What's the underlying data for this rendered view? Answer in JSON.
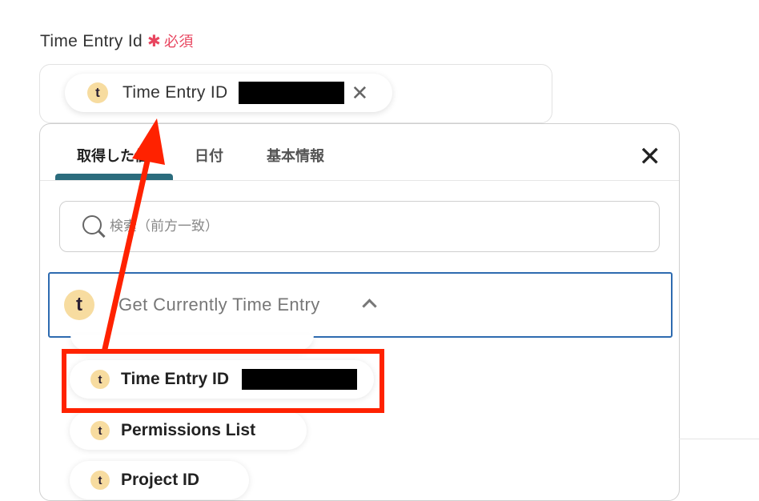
{
  "field": {
    "label": "Time Entry Id",
    "required_star": "✱",
    "required_text": "必須"
  },
  "token": {
    "icon_letter": "t",
    "label": "Time Entry ID",
    "remove_icon": "✕"
  },
  "panel": {
    "tabs": [
      {
        "label": "取得した値"
      },
      {
        "label": "日付"
      },
      {
        "label": "基本情報"
      }
    ],
    "close_icon": "✕",
    "search": {
      "placeholder": "検索（前方一致）"
    },
    "section": {
      "icon_letter": "t",
      "title": "Get Currently Time Entry"
    },
    "items": [
      {
        "icon_letter": "t",
        "label": "Time Entry ID"
      },
      {
        "icon_letter": "t",
        "label": "Permissions List"
      },
      {
        "icon_letter": "t",
        "label": "Project ID"
      }
    ]
  },
  "colors": {
    "required": "#e8455f",
    "tab_indicator": "#2b6c7d",
    "section_border": "#2e6bb0",
    "annotation": "#ff2200",
    "badge": "#f7dca0"
  }
}
